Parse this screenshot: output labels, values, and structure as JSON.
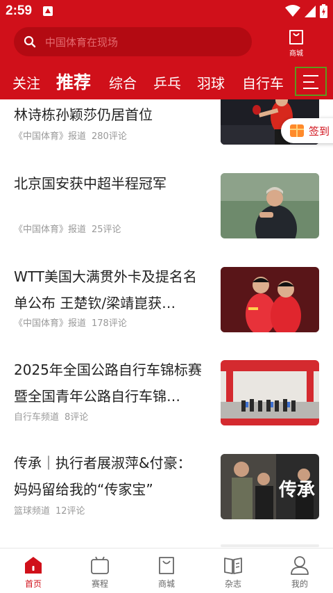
{
  "status": {
    "time": "2:59"
  },
  "search": {
    "placeholder": "中国体育在现场"
  },
  "mall": {
    "label": "商城"
  },
  "tabs": [
    {
      "label": "关注"
    },
    {
      "label": "推荐",
      "active": true
    },
    {
      "label": "综合"
    },
    {
      "label": "乒乓"
    },
    {
      "label": "羽球"
    },
    {
      "label": "自行车"
    }
  ],
  "signin": {
    "label": "签到"
  },
  "articles": [
    {
      "title": "林诗栋孙颖莎仍居首位",
      "source": "《中国体育》报道",
      "comments": "280评论",
      "thumb": "table-tennis-player"
    },
    {
      "title": "北京国安获中超半程冠军",
      "source": "《中国体育》报道",
      "comments": "25评论",
      "thumb": "football-coach"
    },
    {
      "title": "WTT美国大满贯外卡及提名名单公布 王楚钦/梁靖崑获…",
      "source": "《中国体育》报道",
      "comments": "178评论",
      "thumb": "table-tennis-doubles"
    },
    {
      "title": "2025年全国公路自行车锦标赛暨全国青年公路自行车锦…",
      "source": "自行车频道",
      "comments": "8评论",
      "thumb": "cycling-race"
    },
    {
      "title": "传承｜执行者展淑萍&付豪：妈妈留给我的“传家宝”",
      "source": "篮球频道",
      "comments": "12评论",
      "thumb": "basketball-legacy"
    }
  ],
  "thumb_overlay": {
    "calligraphy": "传承"
  },
  "bottom_nav": [
    {
      "label": "首页",
      "icon": "home-icon",
      "active": true
    },
    {
      "label": "赛程",
      "icon": "schedule-icon"
    },
    {
      "label": "商城",
      "icon": "shopping-bag-icon"
    },
    {
      "label": "杂志",
      "icon": "magazine-icon"
    },
    {
      "label": "我的",
      "icon": "profile-icon"
    }
  ],
  "colors": {
    "brand_red": "#d0101a",
    "search_bg": "#b30a12",
    "text_dark": "#222222",
    "text_meta": "#999999"
  }
}
